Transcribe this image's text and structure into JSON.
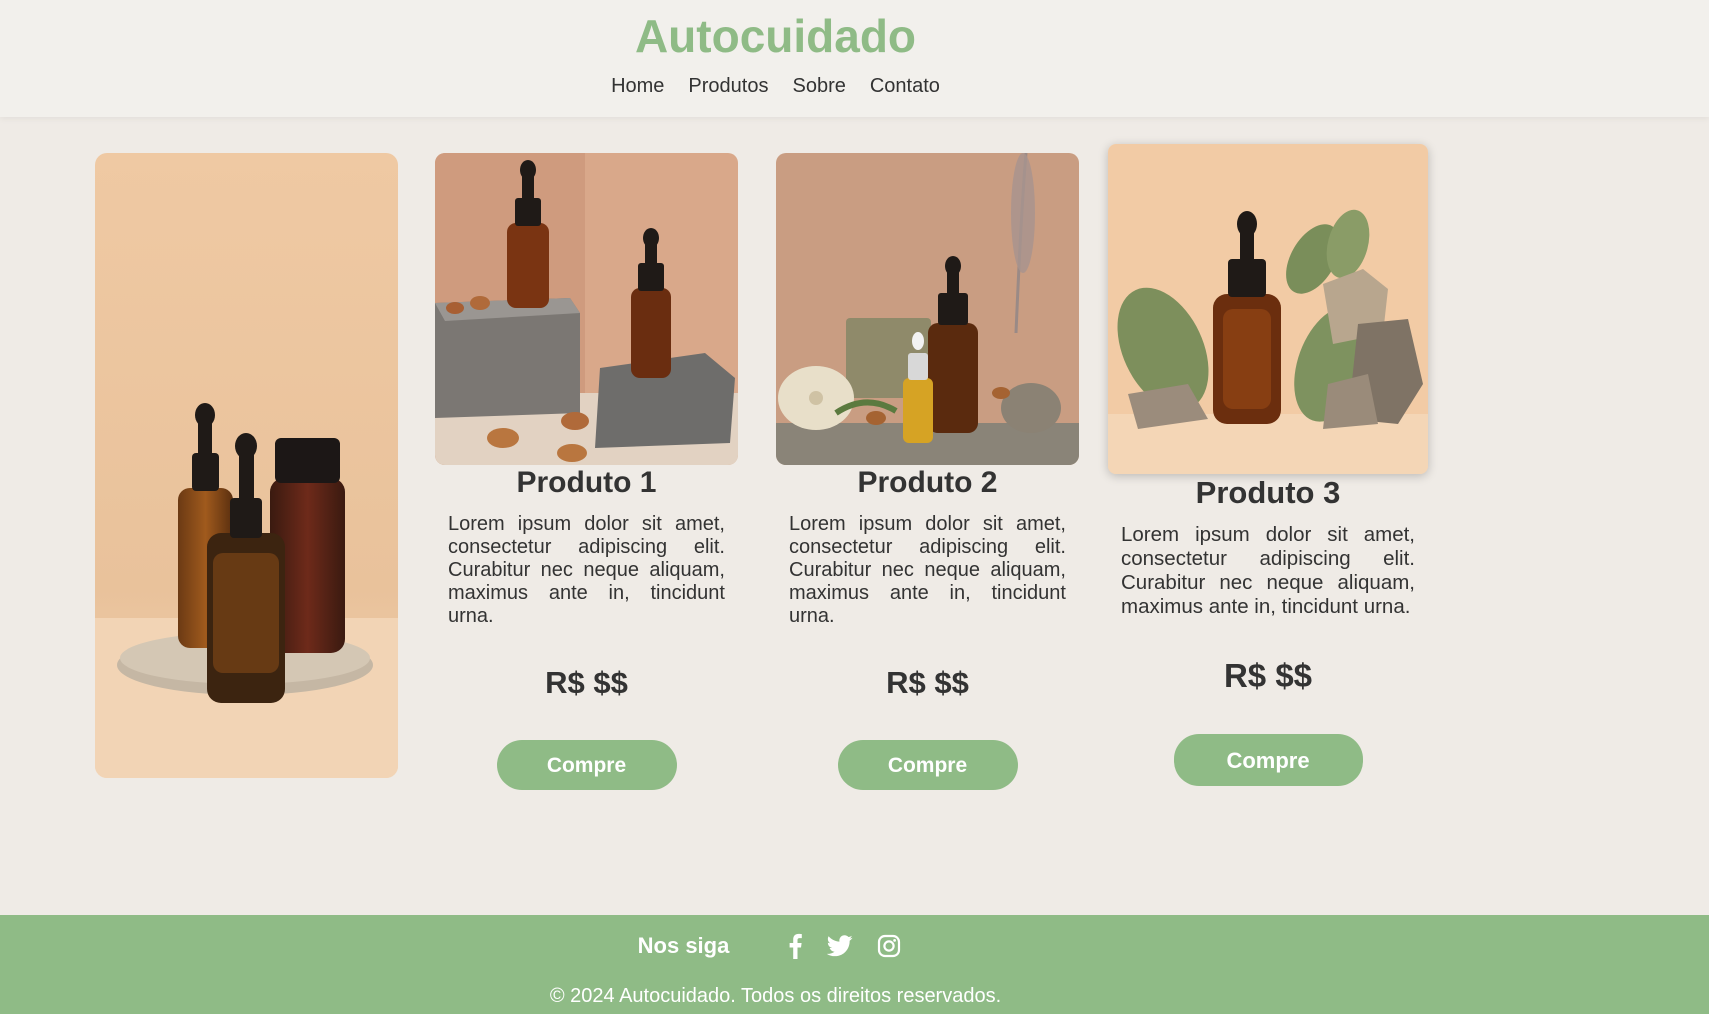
{
  "header": {
    "brand": "Autocuidado",
    "nav": [
      "Home",
      "Produtos",
      "Sobre",
      "Contato"
    ]
  },
  "products": [
    {
      "title": "Produto 1",
      "description": "Lorem ipsum dolor sit amet, consectetur adipiscing elit. Curabitur nec neque aliquam, maximus ante in, tincidunt urna.",
      "price": "R$ $$",
      "button": "Compre"
    },
    {
      "title": "Produto 2",
      "description": "Lorem ipsum dolor sit amet, consectetur adipiscing elit. Curabitur nec neque aliquam, maximus ante in, tincidunt urna.",
      "price": "R$ $$",
      "button": "Compre"
    },
    {
      "title": "Produto 3",
      "description": "Lorem ipsum dolor sit amet, consectetur adipiscing elit. Curabitur nec neque aliquam, maximus ante in, tincidunt urna.",
      "price": "R$ $$",
      "button": "Compre"
    }
  ],
  "footer": {
    "follow_label": "Nos siga",
    "social_icons": [
      "facebook-icon",
      "twitter-icon",
      "instagram-icon"
    ],
    "copyright": "© 2024 Autocuidado. Todos os direitos reservados."
  },
  "colors": {
    "accent": "#8fbb86",
    "background": "#efebe6",
    "header_background": "#f2f0ec",
    "text": "#333333"
  }
}
